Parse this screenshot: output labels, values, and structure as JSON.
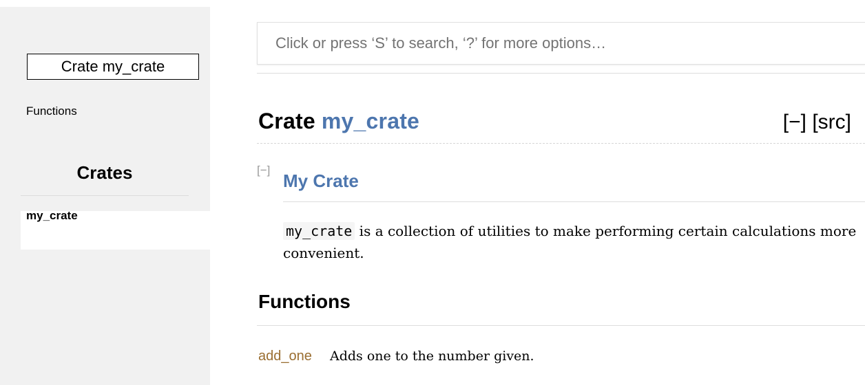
{
  "sidebar": {
    "crate_box_label": "Crate my_crate",
    "functions_link": "Functions",
    "crates_heading": "Crates",
    "crate_items": [
      {
        "label": "my_crate"
      }
    ]
  },
  "search": {
    "placeholder": "Click or press ‘S’ to search, ‘?’ for more options…"
  },
  "main": {
    "title_prefix": "Crate",
    "title_crate_name": "my_crate",
    "collapse_all": "[−]",
    "src_link": "[src]",
    "doc_toggle": "[−]",
    "doc_heading": "My Crate",
    "doc_code": "my_crate",
    "doc_text": " is a collection of utilities to make performing certain calculations more convenient.",
    "functions_heading": "Functions",
    "functions": [
      {
        "name": "add_one",
        "description": "Adds one to the number given."
      }
    ]
  },
  "colors": {
    "sidebar_bg": "#f1f1f1",
    "link_blue": "#4d76ae",
    "fn_brown": "#9a6e31",
    "placeholder_gray": "#737373"
  }
}
